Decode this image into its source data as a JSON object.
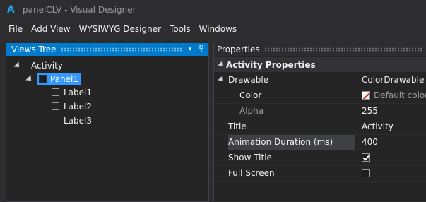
{
  "window": {
    "app_icon": "A",
    "title": "panelCLV - Visual Designer"
  },
  "menu": [
    "File",
    "Add View",
    "WYSIWYG Designer",
    "Tools",
    "Windows"
  ],
  "views_tree": {
    "title": "Views Tree",
    "header_icons": [
      "dropdown-icon",
      "pin-icon"
    ],
    "nodes": [
      {
        "label": "Activity"
      },
      {
        "label": "Panel1",
        "selected": true
      },
      {
        "label": "Label1"
      },
      {
        "label": "Label2"
      },
      {
        "label": "Label3"
      }
    ]
  },
  "properties": {
    "title": "Properties",
    "category": "Activity Properties",
    "rows": [
      {
        "name": "Drawable",
        "value": "ColorDrawable"
      },
      {
        "name": "Color",
        "value": "Default color"
      },
      {
        "name": "Alpha",
        "value": "255"
      },
      {
        "name": "Title",
        "value": "Activity"
      },
      {
        "name": "Animation Duration (ms)",
        "value": "400"
      },
      {
        "name": "Show Title",
        "checked": true
      },
      {
        "name": "Full Screen",
        "checked": false
      }
    ]
  },
  "colors": {
    "accent": "#007acc",
    "selection": "#3399ff",
    "background": "#2d2d30"
  }
}
